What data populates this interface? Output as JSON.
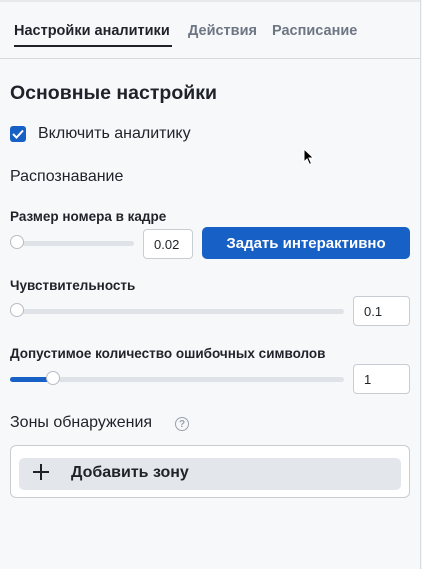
{
  "tabs": [
    {
      "label": "Настройки аналитики",
      "active": true
    },
    {
      "label": "Действия",
      "active": false
    },
    {
      "label": "Расписание",
      "active": false
    }
  ],
  "section_title": "Основные настройки",
  "enable_analytics": {
    "label": "Включить аналитику",
    "checked": true
  },
  "recognition_heading": "Распознавание",
  "plate_size": {
    "label": "Размер номера в кадре",
    "value": "0.02",
    "slider_fraction": 0.0,
    "button_label": "Задать интерактивно"
  },
  "sensitivity": {
    "label": "Чувствительность",
    "value": "0.1",
    "slider_fraction": 0.0
  },
  "error_chars": {
    "label": "Допустимое количество ошибочных символов",
    "value": "1",
    "slider_fraction": 0.13
  },
  "zones": {
    "title": "Зоны обнаружения",
    "help_icon": "question-circle-icon",
    "add_label": "Добавить зону"
  },
  "colors": {
    "accent": "#1760c5",
    "track": "#dfe2e7"
  }
}
